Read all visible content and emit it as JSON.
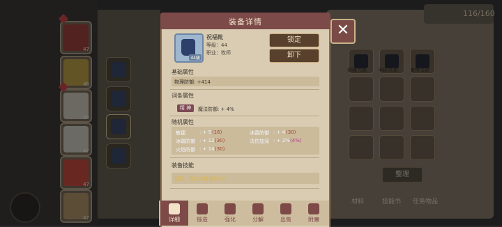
{
  "modal": {
    "title": "装备详情",
    "close_glyph": "✕",
    "item": {
      "name": "祝福靴",
      "level_line": "等级：44",
      "class_line": "职业：牧师",
      "icon_badge": "44級"
    },
    "buttons": {
      "lock": "锁定",
      "unequip": "卸下"
    },
    "base_attr": {
      "title": "基础属性",
      "line": "物理防御: +414"
    },
    "affix_attr": {
      "title": "词条属性",
      "chip": "精 神",
      "line": "魔法防御: + 4%"
    },
    "random_attr": {
      "title": "随机属性",
      "rows": [
        {
          "label": "敏捷",
          "value": ": + 5",
          "extra": "(16)"
        },
        {
          "label": "冰霜防御",
          "value": ": + 4",
          "extra": "(30)"
        },
        {
          "label": "冰霜防御",
          "value": ": + 12",
          "extra": "(30)"
        },
        {
          "label": "法伤加深",
          "value": ": + 2%",
          "extra": "(4%)"
        },
        {
          "label": "火焰防御",
          "value": ": + 14",
          "extra": "(30)"
        }
      ]
    },
    "skill": {
      "title": "装备技能",
      "line": "祝福：治疗效果提升5%"
    }
  },
  "tabs": [
    {
      "label": "详细",
      "icon": "crossed-swords-icon",
      "active": true
    },
    {
      "label": "锻造",
      "icon": "anvil-icon",
      "active": false
    },
    {
      "label": "强化",
      "icon": "arrow-up-icon",
      "active": false
    },
    {
      "label": "分解",
      "icon": "hammer-icon",
      "active": false
    },
    {
      "label": "出售",
      "icon": "coin-icon",
      "active": false
    },
    {
      "label": "附魔",
      "icon": "magic-circle-icon",
      "active": false
    }
  ],
  "background": {
    "top_counter": "116/160",
    "sort_button": "整理",
    "right_tabs": [
      "材料",
      "技能书",
      "任务物品"
    ],
    "grid_labels": [
      "微雕方靴",
      "明昭长靴",
      "束带法靴"
    ],
    "hero_levels": [
      "47",
      "46",
      "48",
      "47",
      "47",
      "47"
    ]
  },
  "colors": {
    "accent": "#7c4a48",
    "panel": "#d9ccb2",
    "button": "#57402c"
  }
}
